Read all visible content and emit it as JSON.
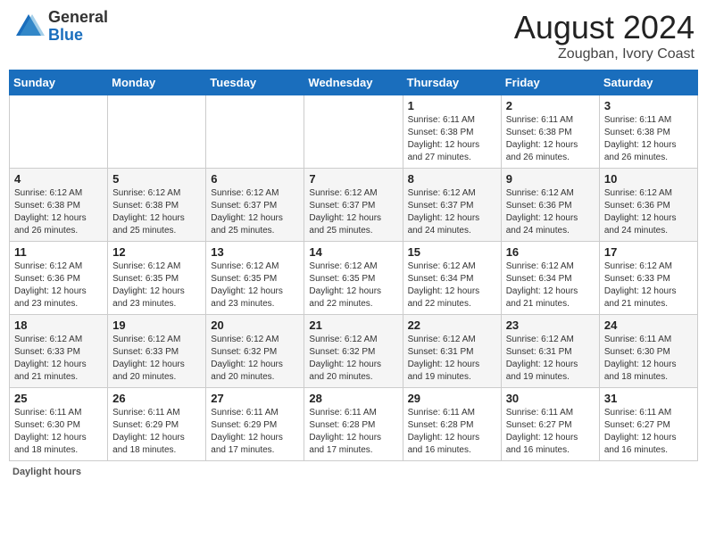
{
  "header": {
    "logo_general": "General",
    "logo_blue": "Blue",
    "month_year": "August 2024",
    "location": "Zougban, Ivory Coast"
  },
  "days_of_week": [
    "Sunday",
    "Monday",
    "Tuesday",
    "Wednesday",
    "Thursday",
    "Friday",
    "Saturday"
  ],
  "footer": {
    "label": "Daylight hours"
  },
  "weeks": [
    [
      {
        "day": "",
        "info": ""
      },
      {
        "day": "",
        "info": ""
      },
      {
        "day": "",
        "info": ""
      },
      {
        "day": "",
        "info": ""
      },
      {
        "day": "1",
        "info": "Sunrise: 6:11 AM\nSunset: 6:38 PM\nDaylight: 12 hours\nand 27 minutes."
      },
      {
        "day": "2",
        "info": "Sunrise: 6:11 AM\nSunset: 6:38 PM\nDaylight: 12 hours\nand 26 minutes."
      },
      {
        "day": "3",
        "info": "Sunrise: 6:11 AM\nSunset: 6:38 PM\nDaylight: 12 hours\nand 26 minutes."
      }
    ],
    [
      {
        "day": "4",
        "info": "Sunrise: 6:12 AM\nSunset: 6:38 PM\nDaylight: 12 hours\nand 26 minutes."
      },
      {
        "day": "5",
        "info": "Sunrise: 6:12 AM\nSunset: 6:38 PM\nDaylight: 12 hours\nand 25 minutes."
      },
      {
        "day": "6",
        "info": "Sunrise: 6:12 AM\nSunset: 6:37 PM\nDaylight: 12 hours\nand 25 minutes."
      },
      {
        "day": "7",
        "info": "Sunrise: 6:12 AM\nSunset: 6:37 PM\nDaylight: 12 hours\nand 25 minutes."
      },
      {
        "day": "8",
        "info": "Sunrise: 6:12 AM\nSunset: 6:37 PM\nDaylight: 12 hours\nand 24 minutes."
      },
      {
        "day": "9",
        "info": "Sunrise: 6:12 AM\nSunset: 6:36 PM\nDaylight: 12 hours\nand 24 minutes."
      },
      {
        "day": "10",
        "info": "Sunrise: 6:12 AM\nSunset: 6:36 PM\nDaylight: 12 hours\nand 24 minutes."
      }
    ],
    [
      {
        "day": "11",
        "info": "Sunrise: 6:12 AM\nSunset: 6:36 PM\nDaylight: 12 hours\nand 23 minutes."
      },
      {
        "day": "12",
        "info": "Sunrise: 6:12 AM\nSunset: 6:35 PM\nDaylight: 12 hours\nand 23 minutes."
      },
      {
        "day": "13",
        "info": "Sunrise: 6:12 AM\nSunset: 6:35 PM\nDaylight: 12 hours\nand 23 minutes."
      },
      {
        "day": "14",
        "info": "Sunrise: 6:12 AM\nSunset: 6:35 PM\nDaylight: 12 hours\nand 22 minutes."
      },
      {
        "day": "15",
        "info": "Sunrise: 6:12 AM\nSunset: 6:34 PM\nDaylight: 12 hours\nand 22 minutes."
      },
      {
        "day": "16",
        "info": "Sunrise: 6:12 AM\nSunset: 6:34 PM\nDaylight: 12 hours\nand 21 minutes."
      },
      {
        "day": "17",
        "info": "Sunrise: 6:12 AM\nSunset: 6:33 PM\nDaylight: 12 hours\nand 21 minutes."
      }
    ],
    [
      {
        "day": "18",
        "info": "Sunrise: 6:12 AM\nSunset: 6:33 PM\nDaylight: 12 hours\nand 21 minutes."
      },
      {
        "day": "19",
        "info": "Sunrise: 6:12 AM\nSunset: 6:33 PM\nDaylight: 12 hours\nand 20 minutes."
      },
      {
        "day": "20",
        "info": "Sunrise: 6:12 AM\nSunset: 6:32 PM\nDaylight: 12 hours\nand 20 minutes."
      },
      {
        "day": "21",
        "info": "Sunrise: 6:12 AM\nSunset: 6:32 PM\nDaylight: 12 hours\nand 20 minutes."
      },
      {
        "day": "22",
        "info": "Sunrise: 6:12 AM\nSunset: 6:31 PM\nDaylight: 12 hours\nand 19 minutes."
      },
      {
        "day": "23",
        "info": "Sunrise: 6:12 AM\nSunset: 6:31 PM\nDaylight: 12 hours\nand 19 minutes."
      },
      {
        "day": "24",
        "info": "Sunrise: 6:11 AM\nSunset: 6:30 PM\nDaylight: 12 hours\nand 18 minutes."
      }
    ],
    [
      {
        "day": "25",
        "info": "Sunrise: 6:11 AM\nSunset: 6:30 PM\nDaylight: 12 hours\nand 18 minutes."
      },
      {
        "day": "26",
        "info": "Sunrise: 6:11 AM\nSunset: 6:29 PM\nDaylight: 12 hours\nand 18 minutes."
      },
      {
        "day": "27",
        "info": "Sunrise: 6:11 AM\nSunset: 6:29 PM\nDaylight: 12 hours\nand 17 minutes."
      },
      {
        "day": "28",
        "info": "Sunrise: 6:11 AM\nSunset: 6:28 PM\nDaylight: 12 hours\nand 17 minutes."
      },
      {
        "day": "29",
        "info": "Sunrise: 6:11 AM\nSunset: 6:28 PM\nDaylight: 12 hours\nand 16 minutes."
      },
      {
        "day": "30",
        "info": "Sunrise: 6:11 AM\nSunset: 6:27 PM\nDaylight: 12 hours\nand 16 minutes."
      },
      {
        "day": "31",
        "info": "Sunrise: 6:11 AM\nSunset: 6:27 PM\nDaylight: 12 hours\nand 16 minutes."
      }
    ]
  ]
}
